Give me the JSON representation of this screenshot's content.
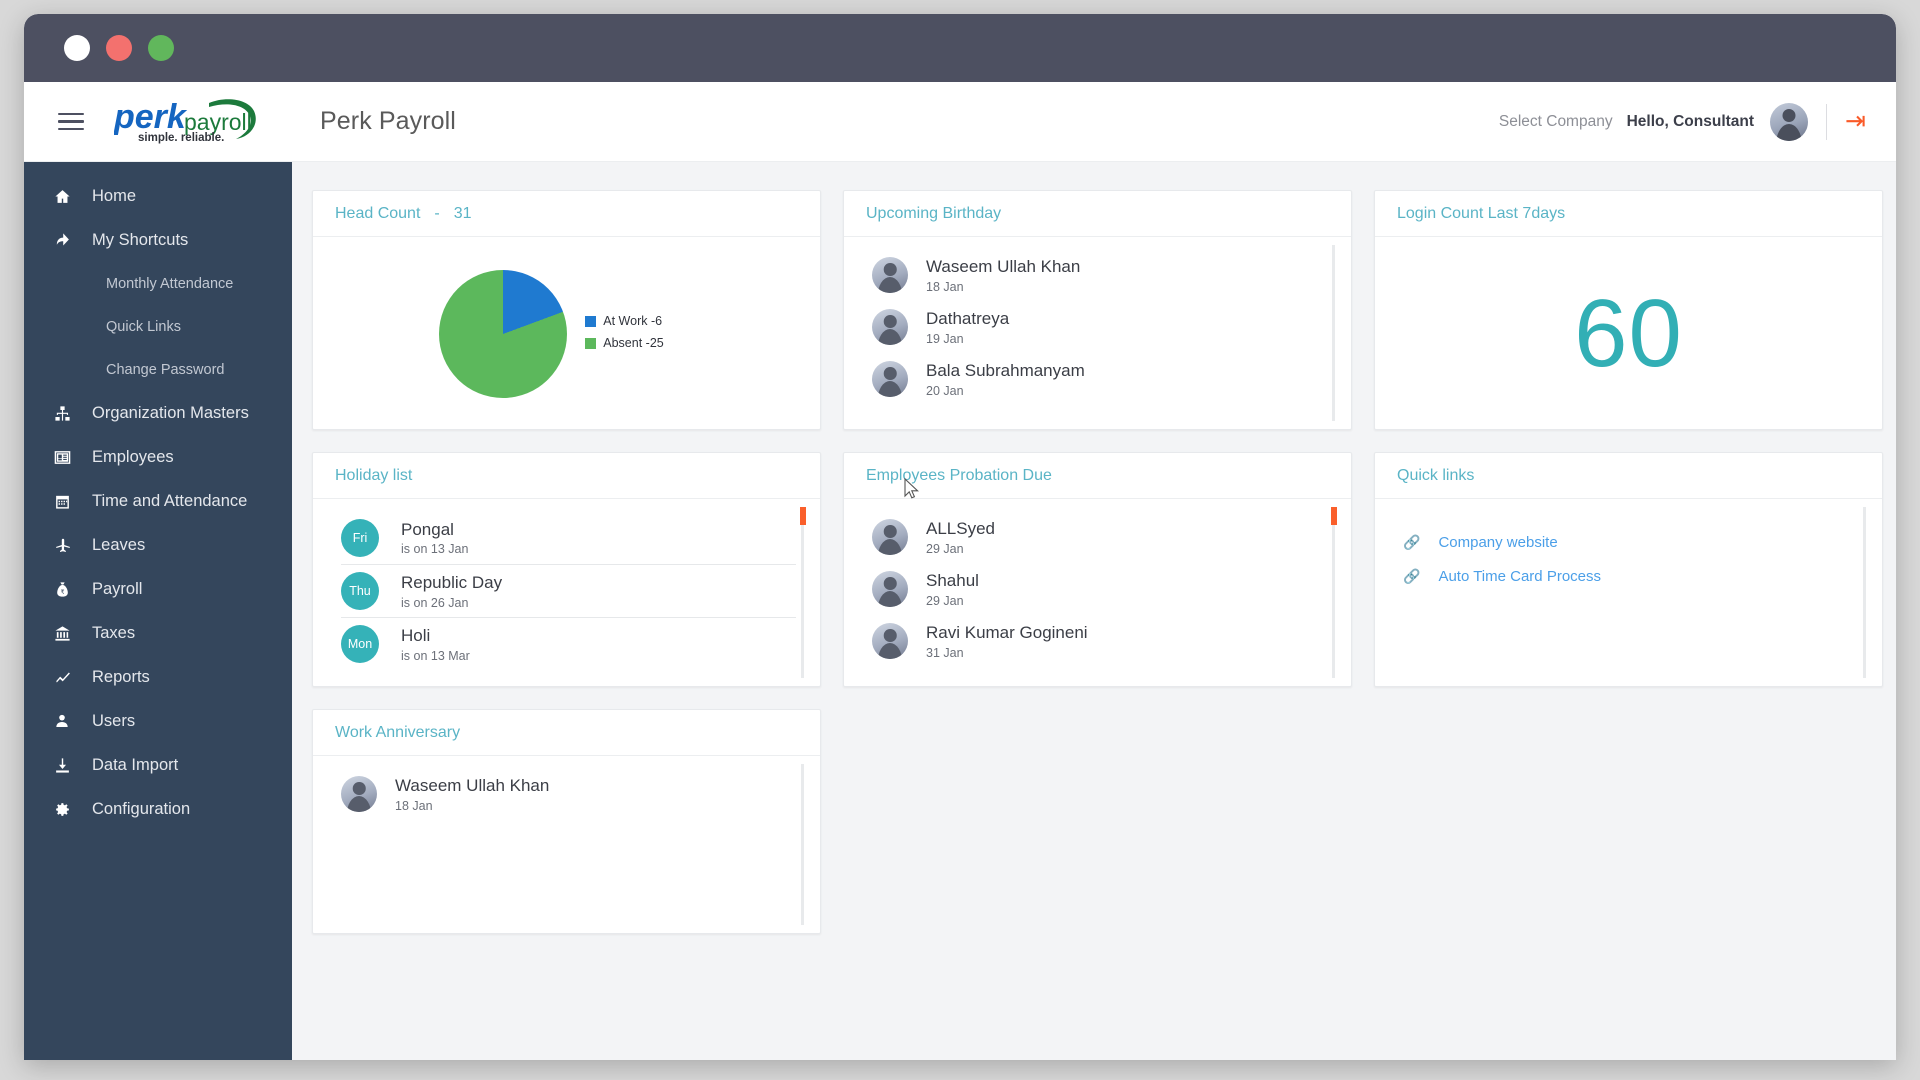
{
  "window": {
    "buttons": [
      "white",
      "red",
      "green"
    ]
  },
  "header": {
    "menu_icon": "hamburger-icon",
    "logo_primary": "perk",
    "logo_secondary": "payroll",
    "logo_tagline": "simple. reliable.",
    "app_title": "Perk Payroll",
    "select_company": "Select Company",
    "greeting": "Hello, Consultant",
    "avatar_icon": "user-avatar",
    "logout_icon": "logout-icon"
  },
  "sidebar": {
    "items": [
      {
        "label": "Home",
        "icon": "home-icon",
        "level": 0
      },
      {
        "label": "My Shortcuts",
        "icon": "shortcut-icon",
        "level": 0
      },
      {
        "label": "Monthly Attendance",
        "icon": "",
        "level": 1
      },
      {
        "label": "Quick Links",
        "icon": "",
        "level": 1
      },
      {
        "label": "Change Password",
        "icon": "",
        "level": 1
      },
      {
        "label": "Organization Masters",
        "icon": "sitemap-icon",
        "level": 0
      },
      {
        "label": "Employees",
        "icon": "id-card-icon",
        "level": 0
      },
      {
        "label": "Time and Attendance",
        "icon": "calendar-icon",
        "level": 0
      },
      {
        "label": "Leaves",
        "icon": "plane-icon",
        "level": 0
      },
      {
        "label": "Payroll",
        "icon": "money-bag-icon",
        "level": 0
      },
      {
        "label": "Taxes",
        "icon": "bank-icon",
        "level": 0
      },
      {
        "label": "Reports",
        "icon": "line-chart-icon",
        "level": 0
      },
      {
        "label": "Users",
        "icon": "user-icon",
        "level": 0
      },
      {
        "label": "Data Import",
        "icon": "download-icon",
        "level": 0
      },
      {
        "label": "Configuration",
        "icon": "gear-icon",
        "level": 0
      }
    ]
  },
  "cards": {
    "head_count": {
      "title": "Head Count",
      "separator": "-",
      "value": "31"
    },
    "upcoming_birthday": {
      "title": "Upcoming Birthday",
      "people": [
        {
          "name": "Waseem Ullah Khan",
          "date": "18 Jan"
        },
        {
          "name": "Dathatreya",
          "date": "19 Jan"
        },
        {
          "name": "Bala Subrahmanyam",
          "date": "20 Jan"
        }
      ]
    },
    "login_count": {
      "title": "Login Count Last 7days",
      "value": "60"
    },
    "holiday_list": {
      "title": "Holiday list",
      "holidays": [
        {
          "day": "Fri",
          "name": "Pongal",
          "date": "is on 13 Jan"
        },
        {
          "day": "Thu",
          "name": "Republic Day",
          "date": "is on 26 Jan"
        },
        {
          "day": "Mon",
          "name": "Holi",
          "date": "is on 13 Mar"
        }
      ]
    },
    "probation_due": {
      "title": "Employees Probation Due",
      "people": [
        {
          "name": "ALLSyed",
          "date": "29 Jan"
        },
        {
          "name": "Shahul",
          "date": "29 Jan"
        },
        {
          "name": "Ravi Kumar Gogineni",
          "date": "31 Jan"
        }
      ]
    },
    "quick_links": {
      "title": "Quick links",
      "links": [
        {
          "label": "Company website",
          "icon": "chain-icon"
        },
        {
          "label": "Auto Time Card Process",
          "icon": "chain-icon"
        }
      ]
    },
    "work_anniversary": {
      "title": "Work Anniversary",
      "people": [
        {
          "name": "Waseem Ullah Khan",
          "date": "18 Jan"
        }
      ]
    }
  },
  "chart_data": {
    "type": "pie",
    "title": "Head Count - 31",
    "categories": [
      "At Work -6",
      "Absent -25"
    ],
    "values": [
      6,
      25
    ],
    "colors": [
      "#1f7ad0",
      "#5cb85c"
    ],
    "total": 31,
    "legend": "right"
  },
  "colors": {
    "sidebar_bg": "#34465c",
    "titlebar_bg": "#4d5061",
    "card_title": "#5ab4c6",
    "accent_teal": "#32afb5",
    "accent_orange": "#fa5f2b",
    "link_blue": "#4b9fe8",
    "pie_blue": "#1f7ad0",
    "pie_green": "#5cb85c"
  }
}
